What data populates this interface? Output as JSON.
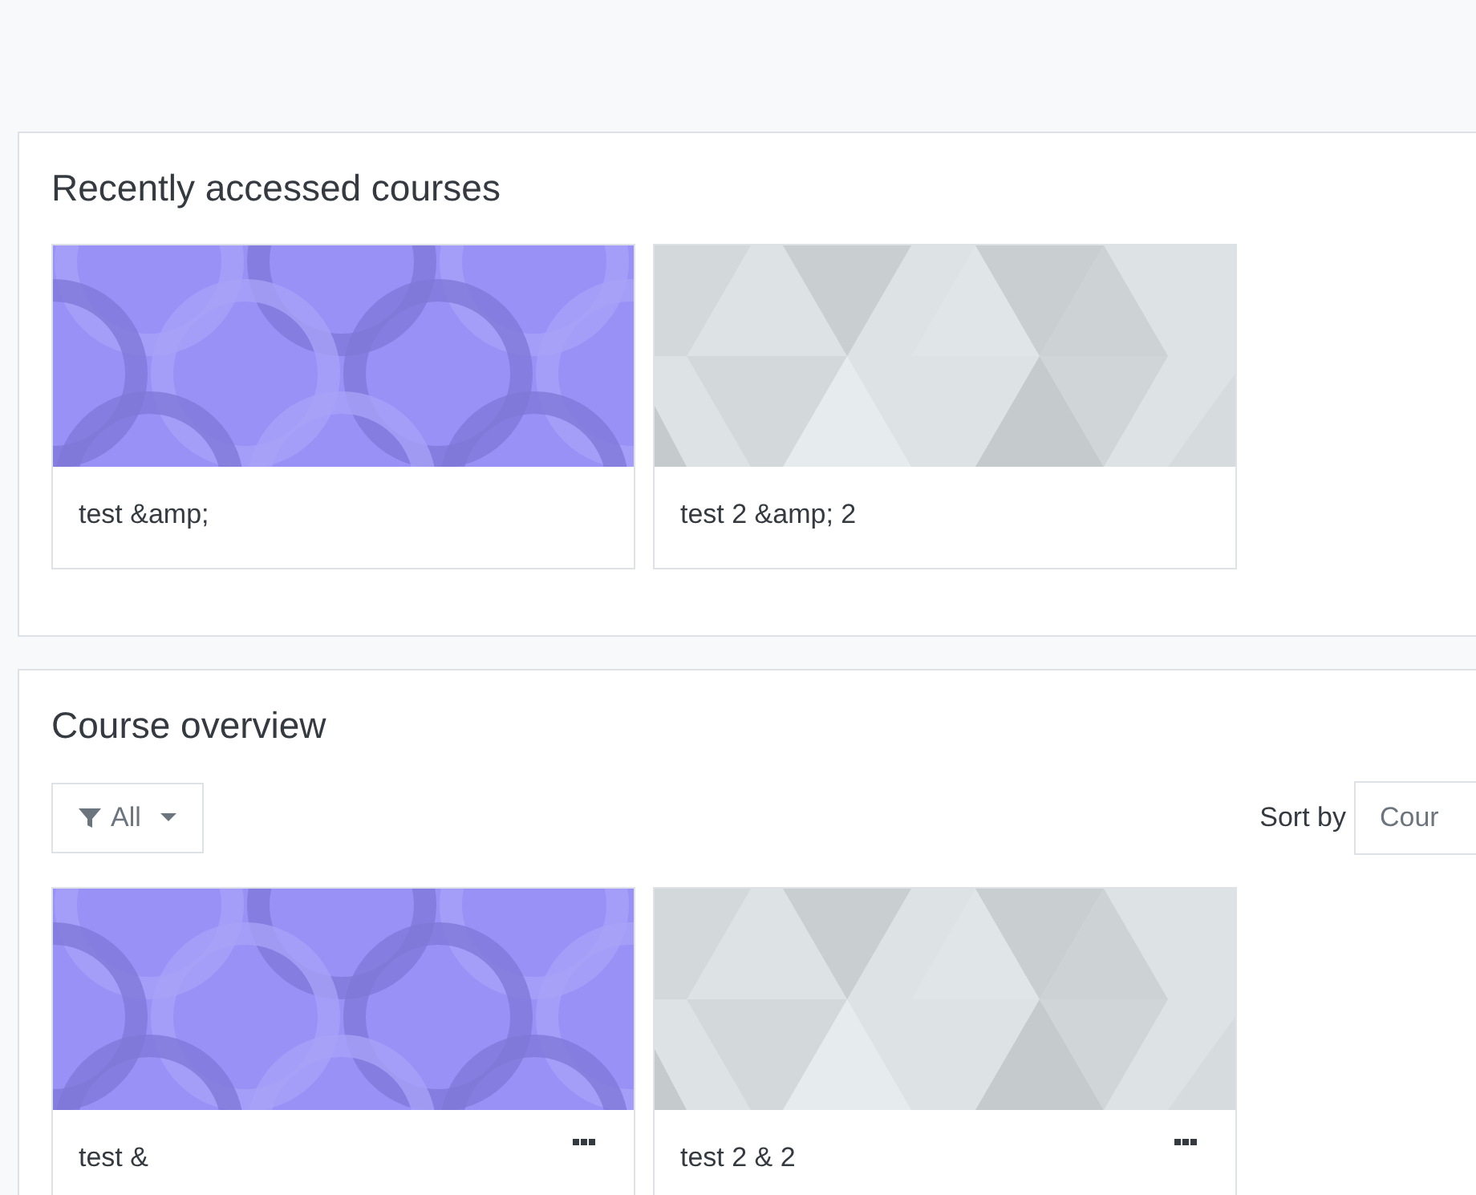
{
  "recent": {
    "title": "Recently accessed courses",
    "courses": [
      {
        "name": "test &amp;",
        "kind": "picture"
      },
      {
        "name": "test 2 &amp; 2",
        "kind": "picture"
      }
    ]
  },
  "overview": {
    "title": "Course overview",
    "filter": {
      "label": "All"
    },
    "sort": {
      "label": "Sort by",
      "value": "Cour"
    },
    "courses": [
      {
        "name": "test &",
        "kind": "picture"
      },
      {
        "name": "test 2 & 2",
        "kind": "picture"
      }
    ]
  }
}
